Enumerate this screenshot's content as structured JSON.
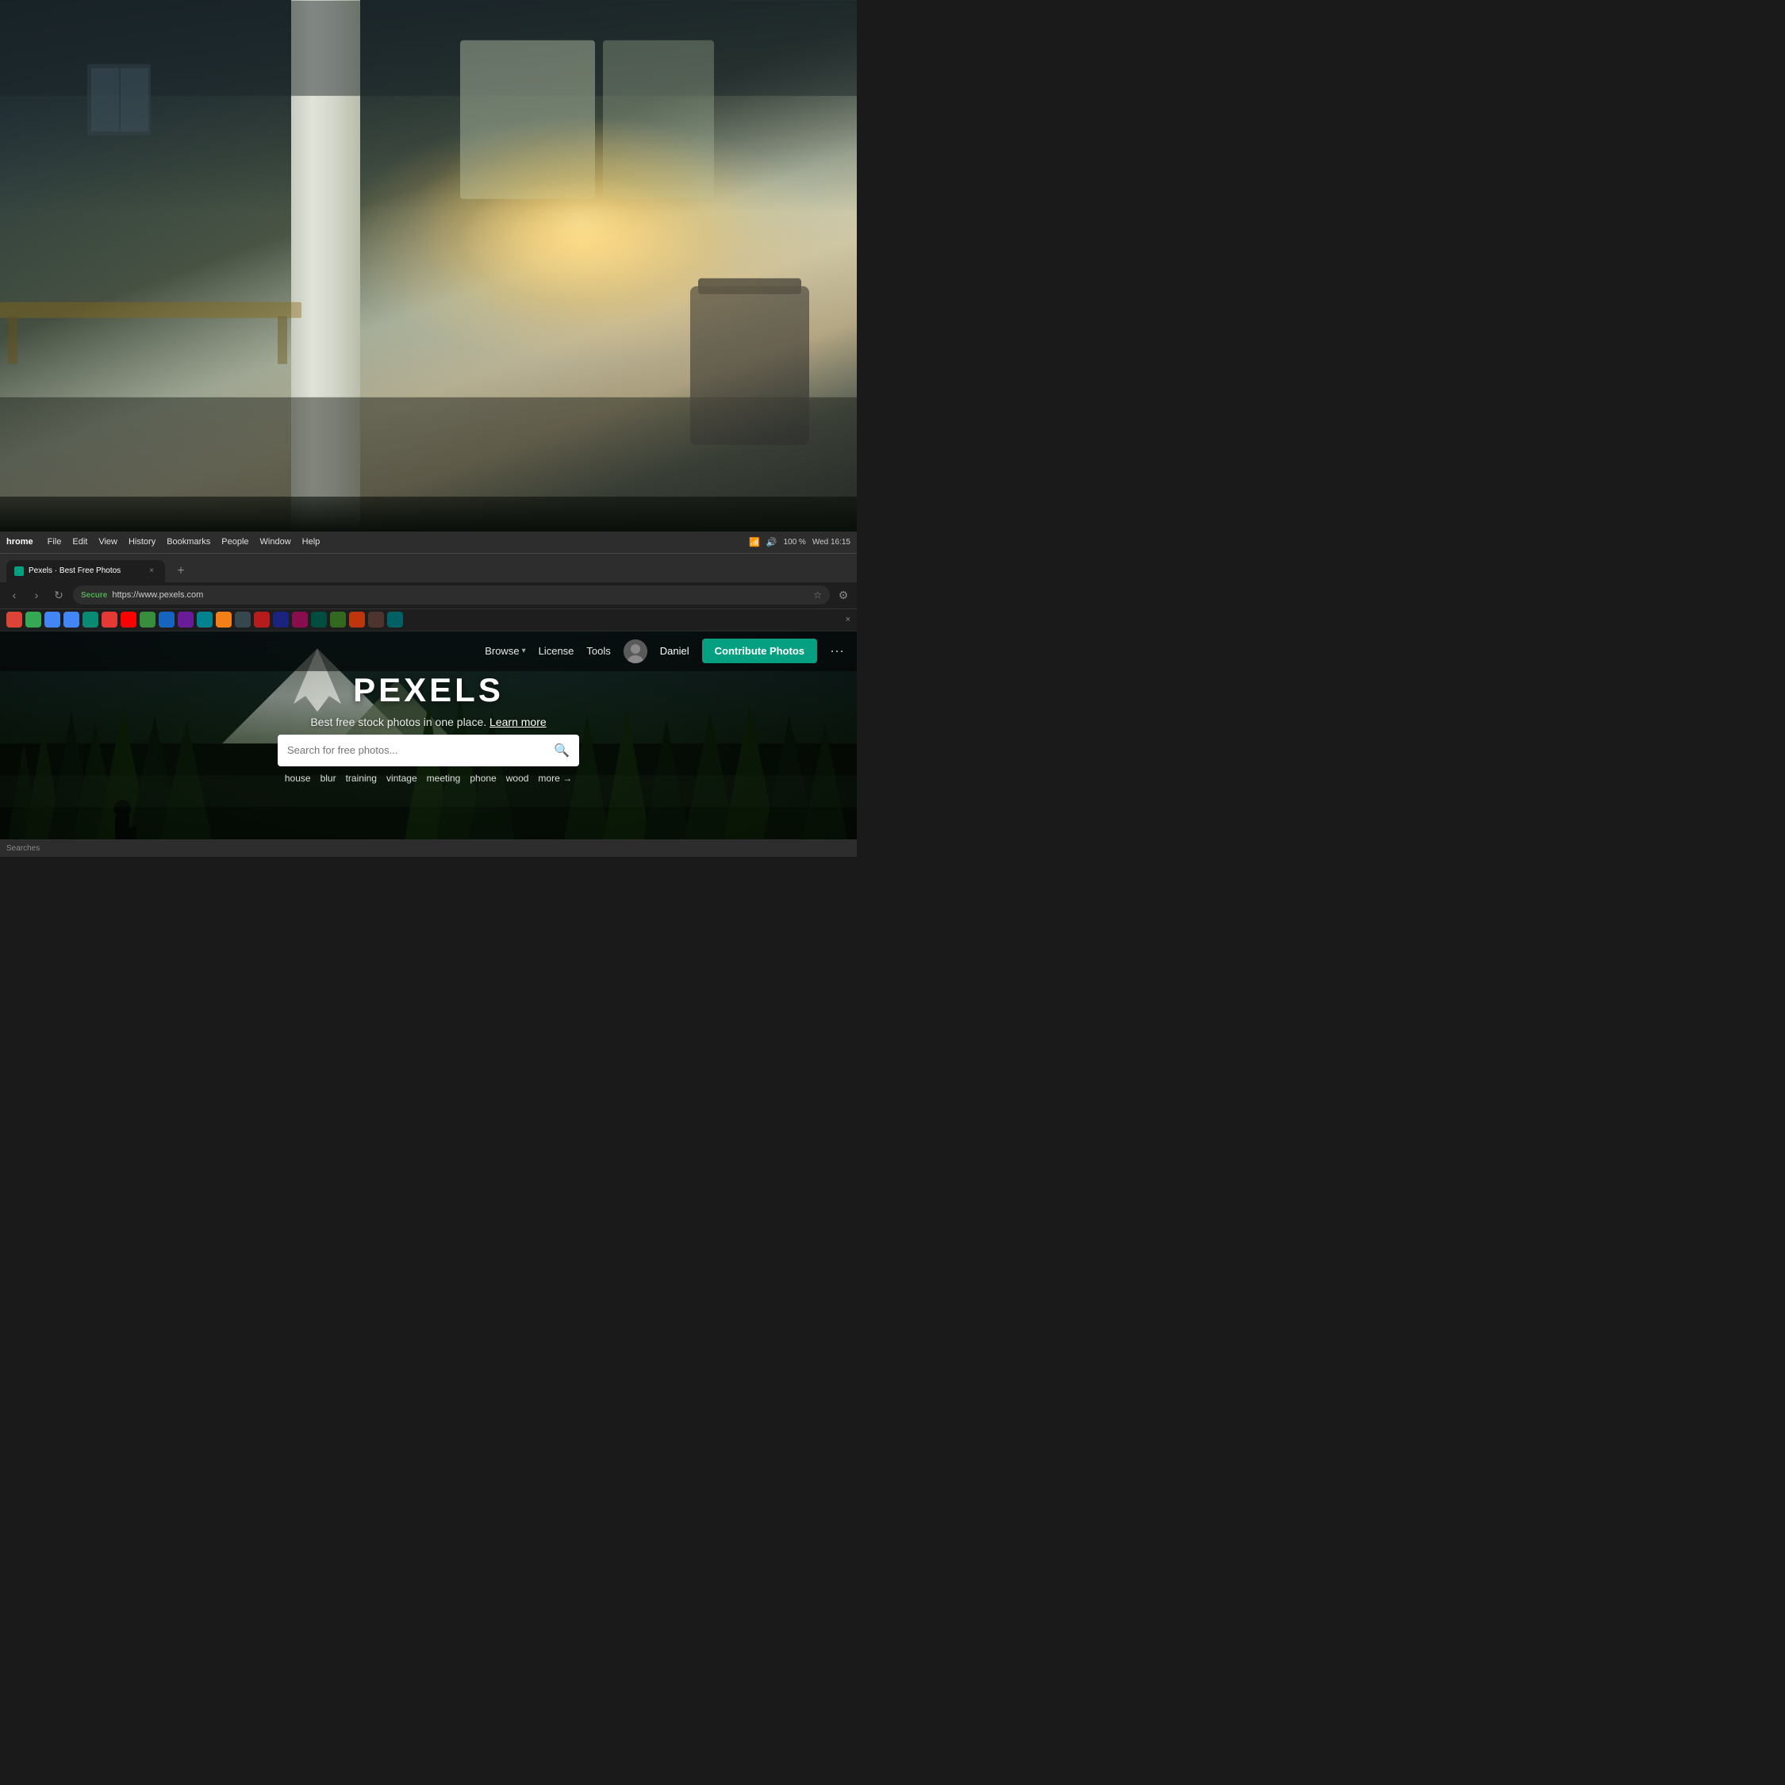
{
  "background": {
    "office": {
      "pillar_color": "#c8ccc0",
      "plant_color": "#2d5a1b"
    }
  },
  "browser": {
    "menu_bar": {
      "app_name": "hrome",
      "items": [
        "File",
        "Edit",
        "View",
        "History",
        "Bookmarks",
        "People",
        "Window",
        "Help"
      ],
      "time": "Wed 16:15",
      "battery": "100 %"
    },
    "tab": {
      "favicon_color": "#05a081",
      "title": "Pexels · Best Free Photos",
      "close_label": "×"
    },
    "address_bar": {
      "secure_label": "Secure",
      "url": "https://www.pexels.com",
      "reload_icon": "↻",
      "back_icon": "‹",
      "forward_icon": "›"
    },
    "new_tab_icon": "+"
  },
  "pexels": {
    "nav": {
      "browse_label": "Browse",
      "browse_chevron": "▾",
      "license_label": "License",
      "tools_label": "Tools",
      "user_name": "Daniel",
      "contribute_label": "Contribute Photos",
      "more_icon": "···"
    },
    "hero": {
      "title": "PEXELS",
      "subtitle": "Best free stock photos in one place.",
      "learn_more": "Learn more",
      "search_placeholder": "Search for free photos...",
      "search_icon": "🔍",
      "tags": [
        "house",
        "blur",
        "training",
        "vintage",
        "meeting",
        "phone",
        "wood",
        "more →"
      ]
    }
  },
  "bottom_bar": {
    "text": "Searches"
  }
}
